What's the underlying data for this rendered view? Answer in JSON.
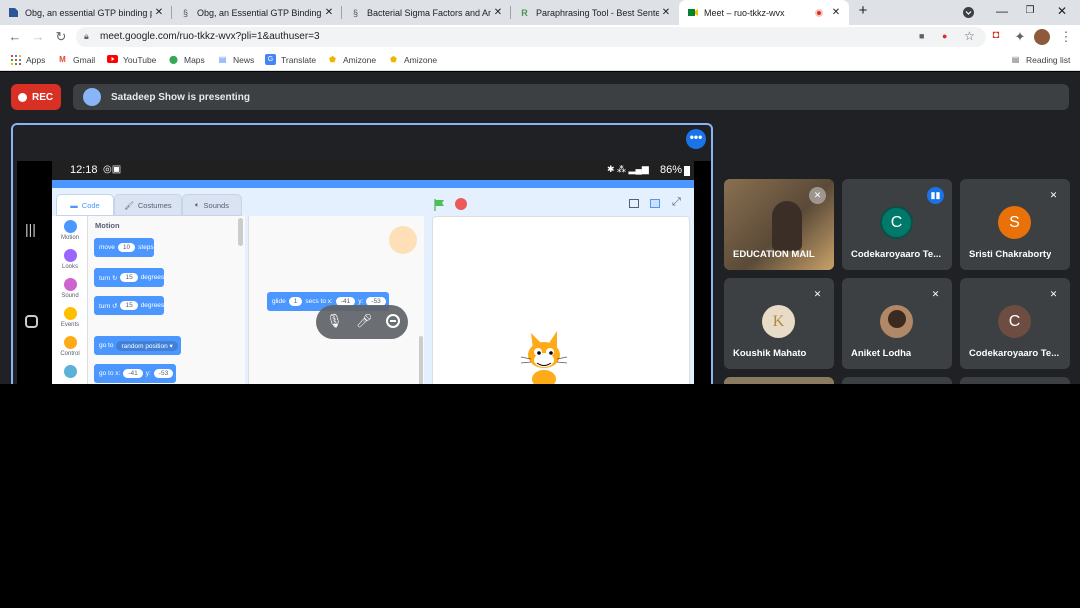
{
  "browser": {
    "tabs": [
      {
        "title": "Obg, an essential GTP binding p",
        "icon": "doc-favicon-icon"
      },
      {
        "title": "Obg, an Essential GTP Binding Pr",
        "icon": "semantic-favicon-icon"
      },
      {
        "title": "Bacterial Sigma Factors and Anti",
        "icon": "semantic-favicon-icon"
      },
      {
        "title": "Paraphrasing Tool - Best Sentenc",
        "icon": "quillbot-favicon-icon"
      },
      {
        "title": "Meet – ruo-tkkz-wvx",
        "icon": "meet-favicon-icon",
        "active": true,
        "recording": true
      }
    ],
    "url": "meet.google.com/ruo-tkkz-wvx?pli=1&authuser=3",
    "bookmarks": [
      {
        "label": "Apps",
        "icon": "apps-grid-icon"
      },
      {
        "label": "Gmail",
        "icon": "gmail-icon"
      },
      {
        "label": "YouTube",
        "icon": "youtube-icon"
      },
      {
        "label": "Maps",
        "icon": "maps-icon"
      },
      {
        "label": "News",
        "icon": "news-icon"
      },
      {
        "label": "Translate",
        "icon": "translate-icon"
      },
      {
        "label": "Amizone",
        "icon": "amizone-icon"
      },
      {
        "label": "Amizone",
        "icon": "amizone-icon"
      }
    ],
    "reading_list": "Reading list"
  },
  "meet": {
    "rec_label": "REC",
    "presenting_text": "Satadeep Show is presenting",
    "phone": {
      "time": "12:18",
      "battery": "86%",
      "scratch": {
        "tabs": [
          "Code",
          "Costumes",
          "Sounds"
        ],
        "categories": [
          "Motion",
          "Looks",
          "Sound",
          "Events",
          "Control"
        ],
        "category_colors": [
          "#4c97ff",
          "#9966ff",
          "#cf63cf",
          "#ffbf00",
          "#ffab19"
        ],
        "section_title": "Motion",
        "blocks": [
          {
            "pre": "move",
            "val": "10",
            "post": "steps"
          },
          {
            "pre": "turn ↻",
            "val": "15",
            "post": "degrees"
          },
          {
            "pre": "turn ↺",
            "val": "15",
            "post": "degrees"
          },
          {
            "pre": "go to",
            "val": "random position ▾",
            "post": ""
          },
          {
            "pre": "go to x:",
            "val": "-41",
            "post": "y:",
            "val2": "-53"
          }
        ],
        "workspace_block": {
          "pre": "glide",
          "val": "1",
          "mid": "secs to x:",
          "val2": "-41",
          "post": "y:",
          "val3": "-53"
        }
      }
    },
    "participants": [
      {
        "name": "EDUCATION MAIL",
        "muted": true,
        "video": true
      },
      {
        "name": "Codekaroyaaro Te...",
        "initial": "C",
        "color": "#00796b",
        "speaking": true
      },
      {
        "name": "Sristi Chakraborty",
        "initial": "S",
        "color": "#e8710a",
        "muted": true
      },
      {
        "name": "Koushik Mahato",
        "muted": true,
        "photo": true
      },
      {
        "name": "Aniket Lodha",
        "muted": true,
        "photo": true
      },
      {
        "name": "Codekaroyaaro Te...",
        "initial": "C",
        "color": "#6d4c41",
        "muted": true
      }
    ]
  }
}
